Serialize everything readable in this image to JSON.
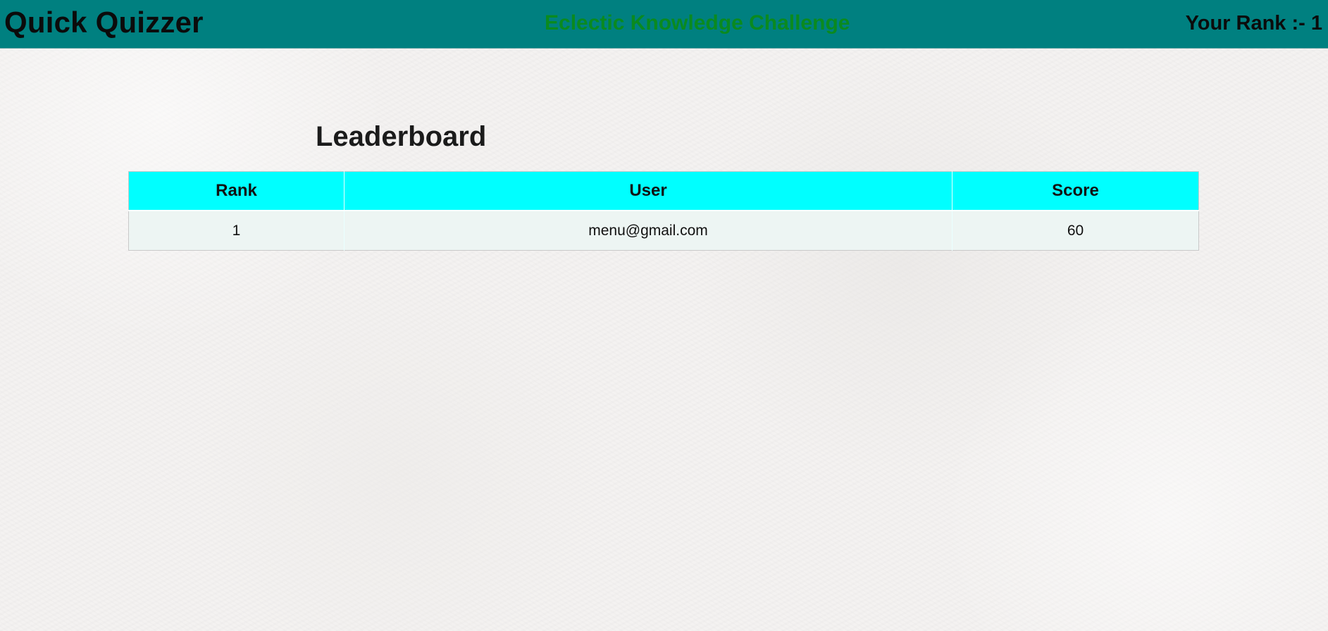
{
  "header": {
    "brand": "Quick Quizzer",
    "quiz_title": "Eclectic Knowledge Challenge",
    "rank_text": "Your Rank :- 1"
  },
  "leaderboard": {
    "title": "Leaderboard",
    "columns": [
      "Rank",
      "User",
      "Score"
    ],
    "rows": [
      {
        "rank": "1",
        "user": "menu@gmail.com",
        "score": "60"
      }
    ]
  },
  "colors": {
    "header_background": "#008080",
    "quiz_title": "#0a8a1f",
    "table_header_background": "#00ffff",
    "table_row_background": "#edf5f3"
  }
}
